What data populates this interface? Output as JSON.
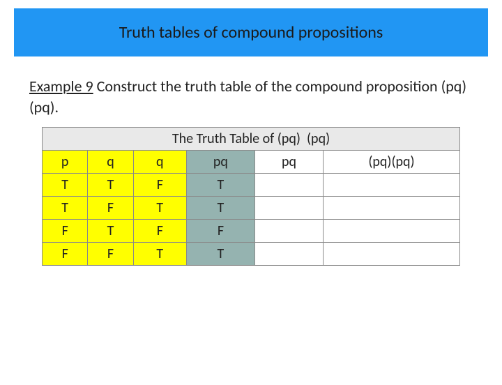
{
  "title": "Truth tables of compound propositions",
  "example": {
    "label": "Example 9",
    "text_before": " Construct the truth table of the compound proposition ",
    "expr": "(p⁡⁡q) ⁡ (p⁡q).",
    "table_caption": "The Truth Table of (p⁡⁡q) ⁡ (p⁡q)"
  },
  "headers": {
    "p": "p",
    "q": "q",
    "not_q": "⁡q",
    "p_or_not_q": "p⁡⁡q",
    "p_and_q": "p⁡q",
    "result": "(p⁡⁡q)⁡(p⁡q)"
  },
  "rows": [
    {
      "p": "T",
      "q": "T",
      "not_q": "F",
      "p_or_not_q": "T",
      "p_and_q": "",
      "result": ""
    },
    {
      "p": "T",
      "q": "F",
      "not_q": "T",
      "p_or_not_q": "T",
      "p_and_q": "",
      "result": ""
    },
    {
      "p": "F",
      "q": "T",
      "not_q": "F",
      "p_or_not_q": "F",
      "p_and_q": "",
      "result": ""
    },
    {
      "p": "F",
      "q": "F",
      "not_q": "T",
      "p_or_not_q": "T",
      "p_and_q": "",
      "result": ""
    }
  ]
}
